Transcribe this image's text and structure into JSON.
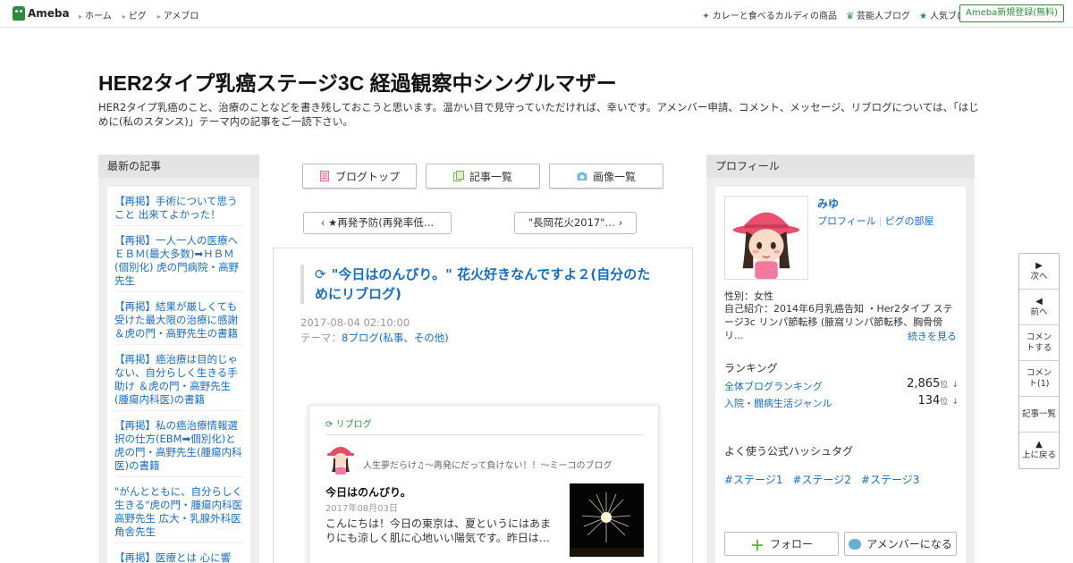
{
  "header": {
    "logo_text": "Ameba",
    "nav": [
      "ホーム",
      "ピグ",
      "アメブロ"
    ],
    "right_links": [
      {
        "icon": "sparkle-icon",
        "label": "カレーと食べるカルディの商品"
      },
      {
        "icon": "crown-icon",
        "label": "芸能人ブログ"
      },
      {
        "icon": "star-icon",
        "label": "人気ブログ"
      }
    ],
    "register_label": "Ameba新規登録(無料)"
  },
  "blog": {
    "title": "HER2タイプ乳癌ステージ3C 経過観察中シングルマザー",
    "description": "HER2タイプ乳癌のこと、治療のことなどを書き残しておこうと思います。温かい目で見守っていただければ、幸いです。アメンバー申請、コメント、メッセージ、リブログについては、「はじめに(私のスタンス)」テーマ内の記事をご一読下さい。"
  },
  "left": {
    "heading": "最新の記事",
    "items": [
      "【再掲】手術について思うこと 出来てよかった！",
      "【再掲】一人一人の医療へ ＥＢＭ(最大多数)➡ＨＢＭ(個別化) 虎の門病院・高野先生",
      "【再掲】結果が厳しくても受けた最大限の治療に感謝 ＆虎の門・高野先生の書籍",
      "【再掲】癌治療は目的じゃない、自分らしく生きる手助け ＆虎の門・高野先生(腫瘍内科医)の書籍",
      "【再掲】私の癌治療情報選択の仕方(EBM➡個別化)と虎の門・高野先生(腫瘍内科医)の書籍",
      "\"がんとともに、自分らしく生きる\"虎の門・腫瘍内科医 高野先生 広大・乳腺外科医 角舎先生",
      "【再掲】医療とは 心に響"
    ]
  },
  "center": {
    "buttons": [
      {
        "icon": "document-icon",
        "label": "ブログトップ"
      },
      {
        "icon": "list-icon",
        "label": "記事一覧"
      },
      {
        "icon": "camera-icon",
        "label": "画像一覧"
      }
    ],
    "prev_label": "★再発予防(再発率低…",
    "next_label": "\"長岡花火2017\"…",
    "article": {
      "title": "\"今日はのんびり。\" 花火好きなんですよ２(自分のためにリブログ)",
      "date": "2017-08-04 02:10:00",
      "theme_prefix": "テーマ：",
      "theme": "8ブログ(私事、その他)"
    },
    "reblog": {
      "label": "リブログ",
      "blog_name": "人生夢だらけ♫〜再発にだって負けない！！〜ミーコのブログ",
      "title": "今日はのんびり。",
      "date": "2017年08月03日",
      "excerpt": "こんにちは！今日の東京は、夏というにはあまりにも涼しく肌に心地いい陽気です。昨日は…"
    }
  },
  "right": {
    "heading": "プロフィール",
    "name": "みゆ",
    "profile_link": "プロフィール",
    "pigg_link": "ピグの部屋",
    "gender": "性別：女性",
    "intro": "自己紹介：2014年6月乳癌告知 ・Her2タイプ ステージ3c リンパ節転移 (腋窩リンパ節転移、胸骨傍リ...",
    "more": "続きを見る",
    "ranking_head": "ランキング",
    "rankings": [
      {
        "label": "全体ブログランキング",
        "value": "2,865",
        "unit": "位",
        "trend": "↓"
      },
      {
        "label": "入院・闘病生活ジャンル",
        "value": "134",
        "unit": "位",
        "trend": "↓"
      }
    ],
    "hashtag_head": "よく使う公式ハッシュタグ",
    "hashtags": [
      "#ステージ1",
      "#ステージ2",
      "#ステージ3"
    ],
    "follow_label": "フォロー",
    "amember_label": "アメンバーになる"
  },
  "float_nav": [
    {
      "icon": "triangle-right-icon",
      "label": "次へ"
    },
    {
      "icon": "triangle-left-icon",
      "label": "前へ"
    },
    {
      "icon": "",
      "label": "コメントする"
    },
    {
      "icon": "",
      "label": "コメント(1)"
    },
    {
      "icon": "",
      "label": "記事一覧"
    },
    {
      "icon": "triangle-up-icon",
      "label": "上に戻る"
    }
  ],
  "colors": {
    "brand": "#2d8c3c",
    "link": "#1a6dbd"
  }
}
